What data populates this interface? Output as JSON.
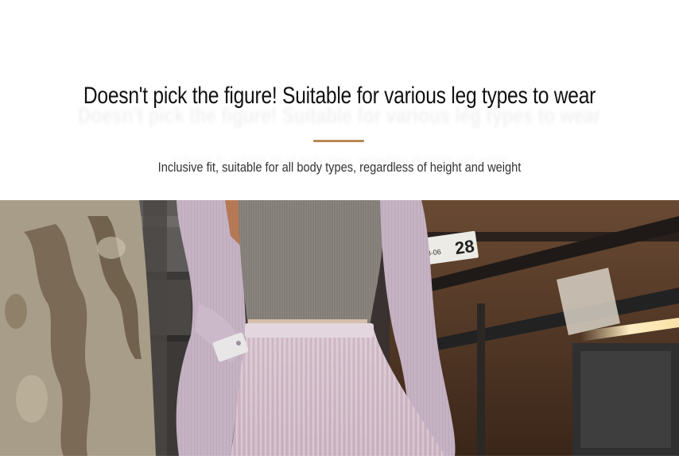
{
  "header": {
    "title": "Doesn't pick the figure! Suitable for various leg types to wear",
    "subtitle": "Inclusive fit, suitable for all body types, regardless of height and weight",
    "accent_color": "#b98755"
  },
  "photo": {
    "sign_number": "28",
    "sign_code": "28-06",
    "colors": {
      "cardigan": "#c7b4c6",
      "top": "#8d8a83",
      "skirt": "#d9c6d0",
      "bark": "#a39680",
      "wood": "#5b3b26"
    }
  }
}
